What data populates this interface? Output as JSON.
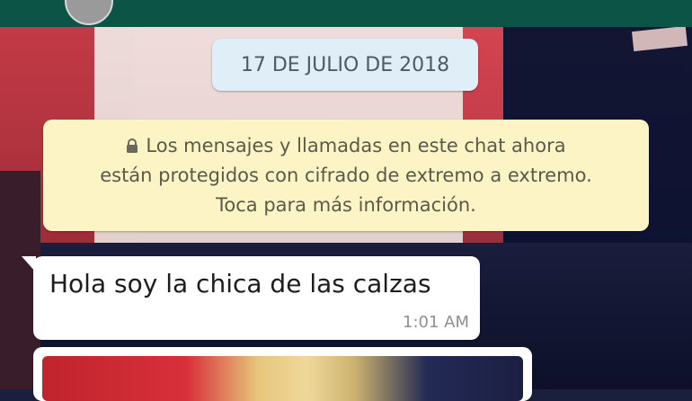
{
  "chat": {
    "date_label": "17 DE JULIO DE 2018",
    "encryption_notice": {
      "line1": "Los mensajes y llamadas en este chat ahora",
      "line2": "están protegidos con cifrado de extremo a extremo.",
      "line3": "Toca para más información.",
      "icon": "lock-icon"
    },
    "messages": [
      {
        "text": "Hola soy la chica de las calzas",
        "time": "1:01 AM",
        "direction": "incoming"
      }
    ]
  },
  "colors": {
    "header": "#0c5446",
    "date_chip": "#dfeef7",
    "notice_bg": "#fcf4c4",
    "bubble_bg": "#ffffff"
  }
}
